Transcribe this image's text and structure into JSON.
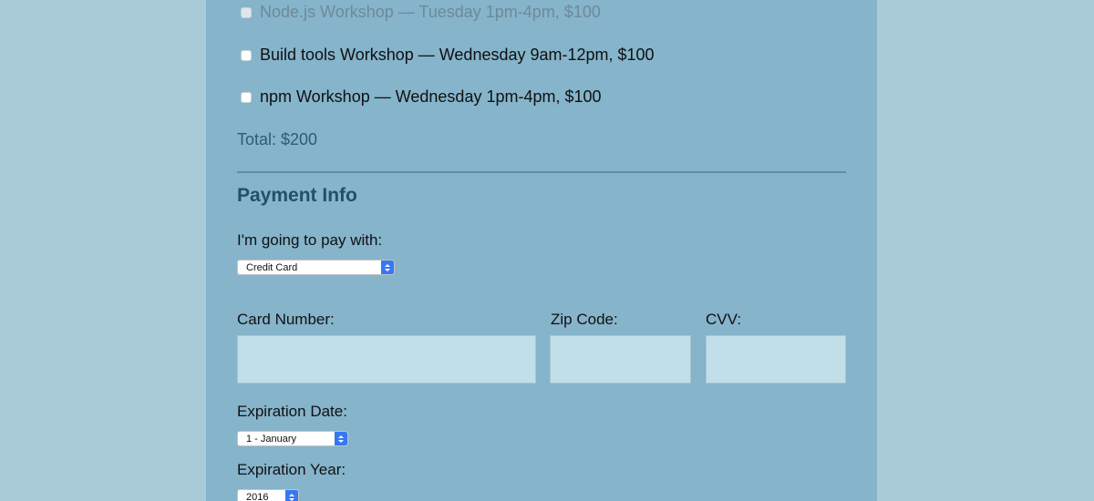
{
  "activities": [
    {
      "label": "Node.js Workshop — Tuesday 1pm-4pm, $100",
      "disabled": true
    },
    {
      "label": "Build tools Workshop — Wednesday 9am-12pm, $100",
      "disabled": false
    },
    {
      "label": "npm Workshop — Wednesday 1pm-4pm, $100",
      "disabled": false
    }
  ],
  "total": "Total: $200",
  "payment": {
    "title": "Payment Info",
    "pay_with_label": "I'm going to pay with:",
    "pay_with_value": "Credit Card",
    "card_number_label": "Card Number:",
    "zip_label": "Zip Code:",
    "cvv_label": "CVV:",
    "card_number_value": "",
    "zip_value": "",
    "cvv_value": "",
    "exp_date_label": "Expiration Date:",
    "exp_date_value": "1 - January",
    "exp_year_label": "Expiration Year:",
    "exp_year_value": "2016"
  },
  "colors": {
    "background": "#a9cbd8",
    "panel": "#85b4cb",
    "heading": "#225068",
    "total": "#2e5c72",
    "input": "#c0dfe8",
    "select_accent": "#3478f6"
  }
}
